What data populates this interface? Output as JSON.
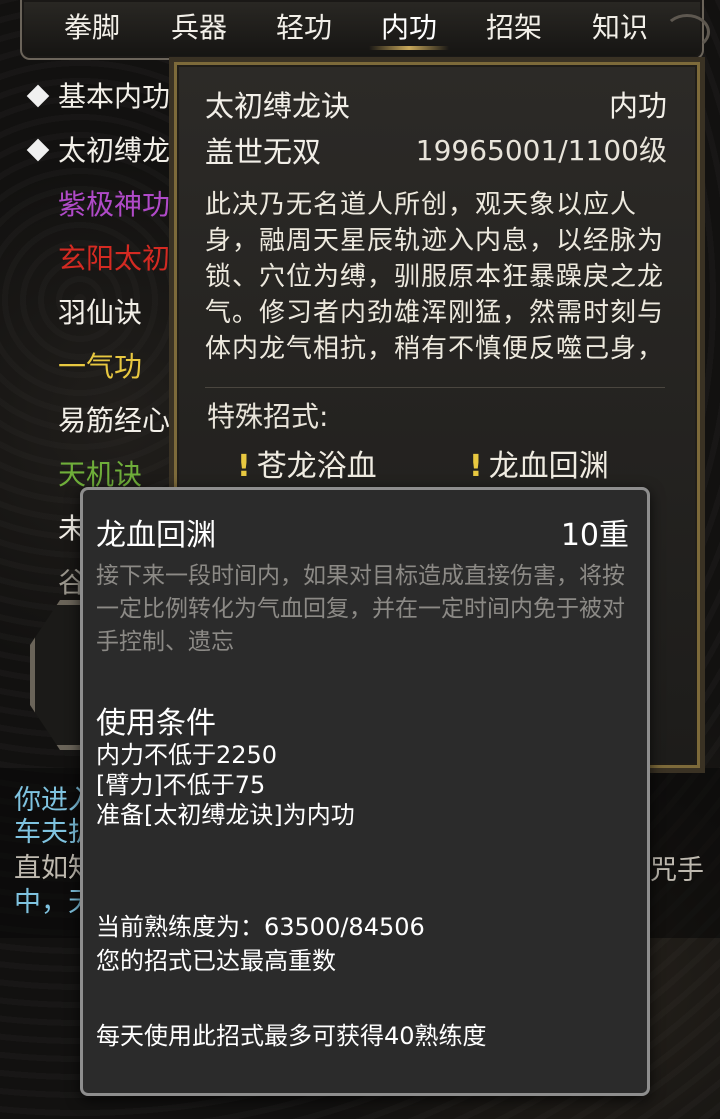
{
  "tabs": [
    {
      "label": "拳脚",
      "active": false
    },
    {
      "label": "兵器",
      "active": false
    },
    {
      "label": "轻功",
      "active": false
    },
    {
      "label": "内功",
      "active": true
    },
    {
      "label": "招架",
      "active": false
    },
    {
      "label": "知识",
      "active": false
    }
  ],
  "skill_list": [
    {
      "label": "基本内功",
      "color": "#f2efe8",
      "equipped": true
    },
    {
      "label": "太初缚龙诀",
      "color": "#f2efe8",
      "equipped": true
    },
    {
      "label": "紫极神功",
      "color": "#b04ac8",
      "equipped": false
    },
    {
      "label": "玄阳太初",
      "color": "#d42a22",
      "equipped": false
    },
    {
      "label": "羽仙诀",
      "color": "#f2efe8",
      "equipped": false
    },
    {
      "label": "一气功",
      "color": "#e8c840",
      "equipped": false
    },
    {
      "label": "易筋经心",
      "color": "#f2efe8",
      "equipped": false
    },
    {
      "label": "天机诀",
      "color": "#6fae3a",
      "equipped": false
    },
    {
      "label": "未",
      "color": "#f2efe8",
      "equipped": false
    },
    {
      "label": "谷",
      "color": "#9a968c",
      "equipped": false
    }
  ],
  "detail": {
    "name": "太初缚龙诀",
    "type": "内功",
    "rank": "盖世无双",
    "level": "19965001/1100级",
    "description": "此决乃无名道人所创，观天象以应人身，融周天星辰轨迹入内息，以经脉为锁、穴位为缚，驯服原本狂暴躁戾之龙气。修习者内劲雄浑刚猛，然需时刻与体内龙气相抗，稍有不慎便反噬己身，",
    "special_label": "特殊招式:",
    "special_moves": [
      "苍龙浴血",
      "龙血回渊"
    ]
  },
  "chat": [
    {
      "text": "你进入",
      "color": "#7fc3e0"
    },
    {
      "text": "车夫护",
      "color": "#7fc3e0"
    },
    {
      "text": "直如知",
      "color": "#bfbab0"
    },
    {
      "text": "中，天",
      "color": "#7fc3e0"
    }
  ],
  "chat_right": "咒手",
  "popup": {
    "title": "龙血回渊",
    "level": "10重",
    "description": "接下来一段时间内，如果对目标造成直接伤害，将按一定比例转化为气血回复，并在一定时间内免于被对手控制、遗忘",
    "conditions_title": "使用条件",
    "conditions": [
      "内力不低于2250",
      "[臂力]不低于75",
      "准备[太初缚龙诀]为内功"
    ],
    "proficiency": "当前熟练度为：63500/84506",
    "max_note": "您的招式已达最高重数",
    "daily_note": "每天使用此招式最多可获得40熟练度"
  }
}
